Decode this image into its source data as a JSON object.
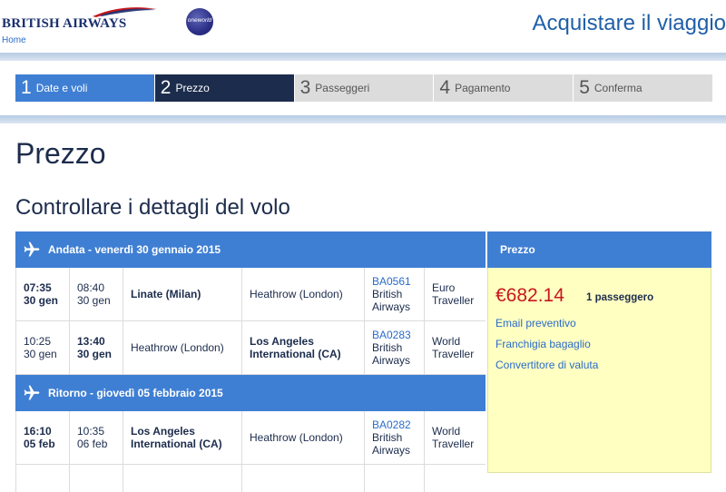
{
  "header": {
    "logo_text": "BRITISH AIRWAYS",
    "home_link": "Home",
    "oneworld_text": "oneworld",
    "heading": "Acquistare il viaggio"
  },
  "steps": [
    {
      "num": "1",
      "label": "Date e voli",
      "state": "done"
    },
    {
      "num": "2",
      "label": "Prezzo",
      "state": "active"
    },
    {
      "num": "3",
      "label": "Passeggeri",
      "state": "pending"
    },
    {
      "num": "4",
      "label": "Pagamento",
      "state": "pending"
    },
    {
      "num": "5",
      "label": "Conferma",
      "state": "pending"
    }
  ],
  "page": {
    "title": "Prezzo",
    "subtitle": "Controllare i dettagli del volo"
  },
  "outbound": {
    "header": "Andata - venerdì 30 gennaio 2015",
    "flights": [
      {
        "dep_time": "07:35",
        "dep_date": "30 gen",
        "arr_time": "08:40",
        "arr_date": "30 gen",
        "from": "Linate (Milan)",
        "to": "Heathrow (London)",
        "flight_no": "BA0561",
        "carrier_1": "British",
        "carrier_2": "Airways",
        "cabin_1": "Euro",
        "cabin_2": "Traveller"
      },
      {
        "dep_time": "10:25",
        "dep_date": "30 gen",
        "arr_time": "13:40",
        "arr_date": "30 gen",
        "from": "Heathrow (London)",
        "to_1": "Los Angeles",
        "to_2": "International (CA)",
        "flight_no": "BA0283",
        "carrier_1": "British",
        "carrier_2": "Airways",
        "cabin_1": "World",
        "cabin_2": "Traveller"
      }
    ]
  },
  "return": {
    "header": "Ritorno - giovedì 05 febbraio 2015",
    "flights": [
      {
        "dep_time": "16:10",
        "dep_date": "05 feb",
        "arr_time": "10:35",
        "arr_date": "06 feb",
        "from_1": "Los Angeles",
        "from_2": "International (CA)",
        "to": "Heathrow (London)",
        "flight_no": "BA0282",
        "carrier_1": "British",
        "carrier_2": "Airways",
        "cabin_1": "World",
        "cabin_2": "Traveller"
      }
    ]
  },
  "price": {
    "header": "Prezzo",
    "amount": "€682.14",
    "passengers": "1 passeggero",
    "links": [
      "Email preventivo",
      "Franchigia bagaglio",
      "Convertitore di valuta"
    ]
  },
  "colors": {
    "accent": "#3f7fd3",
    "navy": "#1c2c4c",
    "price_red": "#c8171e",
    "price_bg": "#ffffc2",
    "link": "#2a6cc9"
  }
}
